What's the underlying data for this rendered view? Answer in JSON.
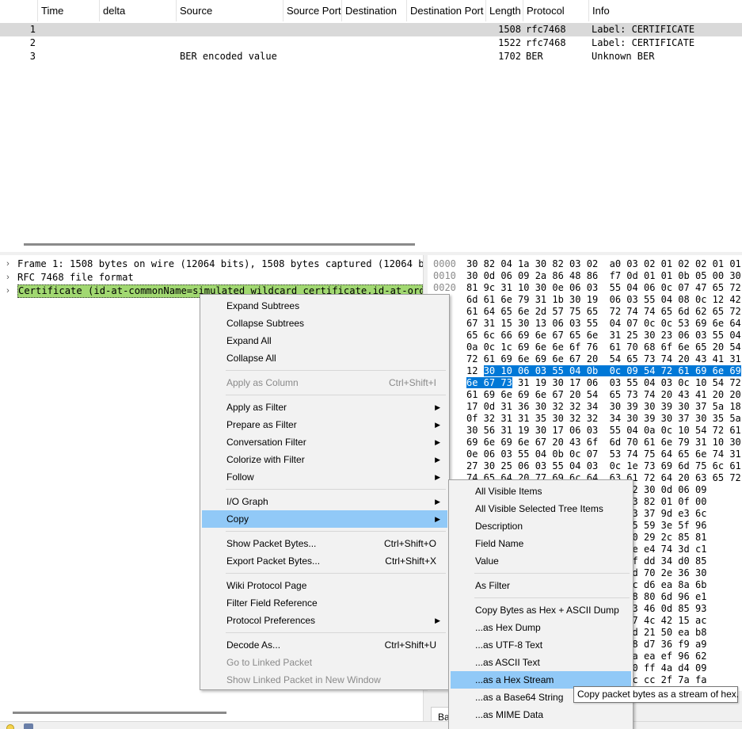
{
  "packet_list": {
    "columns": [
      "Time",
      "delta",
      "Source",
      "Source Port",
      "Destination",
      "Destination Port",
      "Length",
      "Protocol",
      "Info"
    ],
    "rows": [
      {
        "no": "1",
        "source": "",
        "length": "1508",
        "protocol": "rfc7468",
        "info": "Label: CERTIFICATE"
      },
      {
        "no": "2",
        "source": "",
        "length": "1522",
        "protocol": "rfc7468",
        "info": "Label: CERTIFICATE"
      },
      {
        "no": "3",
        "source": "BER encoded value",
        "length": "1702",
        "protocol": "BER",
        "info": "Unknown BER"
      }
    ]
  },
  "details": {
    "rows": [
      "Frame 1: 1508 bytes on wire (12064 bits), 1508 bytes captured (12064 bits)",
      "RFC 7468 file format",
      "Certificate (id-at-commonName=simulated wildcard certificate,id-at-organi"
    ]
  },
  "bytes": {
    "rows": [
      {
        "off": "0000",
        "hex": "30 82 04 1a 30 82 03 02  a0 03 02 01 02 02 01 01"
      },
      {
        "off": "0010",
        "hex": "30 0d 06 09 2a 86 48 86  f7 0d 01 01 0b 05 00 30"
      },
      {
        "off": "0020",
        "hex": "81 9c 31 10 30 0e 06 03  55 04 06 0c 07 47 65 72"
      },
      {
        "off": "",
        "hex": "6d 61 6e 79 31 1b 30 19  06 03 55 04 08 0c 12 42"
      },
      {
        "off": "",
        "hex": "61 64 65 6e 2d 57 75 65  72 74 74 65 6d 62 65 72"
      },
      {
        "off": "",
        "hex": "67 31 15 30 13 06 03 55  04 07 0c 0c 53 69 6e 64"
      },
      {
        "off": "",
        "hex": "65 6c 66 69 6e 67 65 6e  31 25 30 23 06 03 55 04"
      },
      {
        "off": "",
        "hex": "0a 0c 1c 69 6e 6e 6f 76  61 70 68 6f 6e 65 20 54"
      },
      {
        "off": "",
        "hex": "72 61 69 6e 69 6e 67 20  54 65 73 74 20 43 41 31"
      },
      {
        "off": "",
        "hex": "12 ",
        "sel": "30 10 06 03 55 04 0b  0c 09 54 72 61 69 6e 69"
      },
      {
        "off": "",
        "hex": "",
        "sel": "6e 67 73",
        "tail": " 31 19 30 17 06  03 55 04 03 0c 10 54 72"
      },
      {
        "off": "",
        "hex": "61 69 6e 69 6e 67 20 54  65 73 74 20 43 41 20 20"
      },
      {
        "off": "",
        "hex": "17 0d 31 36 30 32 32 34  30 39 30 39 30 37 5a 18"
      },
      {
        "off": "",
        "hex": "0f 32 31 31 35 30 32 32  34 30 39 30 37 30 35 5a"
      },
      {
        "off": "",
        "hex": "30 56 31 19 30 17 06 03  55 04 0a 0c 10 54 72 61"
      },
      {
        "off": "",
        "hex": "69 6e 69 6e 67 20 43 6f  6d 70 61 6e 79 31 10 30"
      },
      {
        "off": "",
        "hex": "0e 06 03 55 04 0b 0c 07  53 74 75 64 65 6e 74 31"
      },
      {
        "off": "",
        "hex": "27 30 25 06 03 55 04 03  0c 1e 73 69 6d 75 6c 61"
      },
      {
        "off": "",
        "hex": "74 65 64 20 77 69 6c 64  63 61 72 64 20 63 65 72"
      },
      {
        "off": "",
        "hex": "                         01 22 30 0d 06 09"
      },
      {
        "off": "",
        "hex": "                         00 03 82 01 0f 00"
      },
      {
        "off": "",
        "hex": "                         10 f3 37 9d e3 6c"
      },
      {
        "off": "",
        "hex": "                         b5 b5 59 3e 5f 96"
      },
      {
        "off": "",
        "hex": "                         fb 00 29 2c 85 81"
      },
      {
        "off": "",
        "hex": "                         ce fe e4 74 3d c1"
      },
      {
        "off": "",
        "hex": "                         63 df dd 34 d0 85"
      },
      {
        "off": "",
        "hex": "                         1d 5d 70 2e 36 30"
      },
      {
        "off": "",
        "hex": "                         6c fc d6 ea 8a 6b"
      },
      {
        "off": "",
        "hex": "                         07 a8 80 6d 96 e1"
      },
      {
        "off": "",
        "hex": "                         4d 93 46 0d 85 93"
      },
      {
        "off": "",
        "hex": "                         ec 77 4c 42 15 ac"
      },
      {
        "off": "",
        "hex": "                         85 5d 21 50 ea b8"
      },
      {
        "off": "",
        "hex": "                         4a e8 d7 36 f9 a9"
      },
      {
        "off": "",
        "hex": "                         d6 ca ea ef 96 62"
      },
      {
        "off": "",
        "hex": "                         3b 60 ff 4a d4 09"
      },
      {
        "off": "",
        "hex": "                         ad 9c cc 2f 7a fa"
      }
    ],
    "tab_label": "Ba"
  },
  "context_menu": {
    "items": [
      {
        "label": "Expand Subtrees"
      },
      {
        "label": "Collapse Subtrees"
      },
      {
        "label": "Expand All"
      },
      {
        "label": "Collapse All"
      },
      {
        "label": "Apply as Column",
        "shortcut": "Ctrl+Shift+I",
        "disabled": true
      },
      {
        "label": "Apply as Filter",
        "submenu": true
      },
      {
        "label": "Prepare as Filter",
        "submenu": true
      },
      {
        "label": "Conversation Filter",
        "submenu": true
      },
      {
        "label": "Colorize with Filter",
        "submenu": true
      },
      {
        "label": "Follow",
        "submenu": true
      },
      {
        "label": "I/O Graph",
        "submenu": true
      },
      {
        "label": "Copy",
        "submenu": true,
        "highlighted": true
      },
      {
        "label": "Show Packet Bytes...",
        "shortcut": "Ctrl+Shift+O"
      },
      {
        "label": "Export Packet Bytes...",
        "shortcut": "Ctrl+Shift+X"
      },
      {
        "label": "Wiki Protocol Page"
      },
      {
        "label": "Filter Field Reference"
      },
      {
        "label": "Protocol Preferences",
        "submenu": true
      },
      {
        "label": "Decode As...",
        "shortcut": "Ctrl+Shift+U"
      },
      {
        "label": "Go to Linked Packet",
        "disabled": true
      },
      {
        "label": "Show Linked Packet in New Window",
        "disabled": true
      }
    ]
  },
  "copy_submenu": {
    "items": [
      {
        "label": "All Visible Items"
      },
      {
        "label": "All Visible Selected Tree Items"
      },
      {
        "label": "Description"
      },
      {
        "label": "Field Name"
      },
      {
        "label": "Value"
      },
      {
        "label": "As Filter"
      },
      {
        "label": "Copy Bytes as Hex + ASCII Dump"
      },
      {
        "label": "...as Hex Dump"
      },
      {
        "label": "...as UTF-8 Text"
      },
      {
        "label": "...as ASCII Text"
      },
      {
        "label": "...as a Hex Stream",
        "highlighted": true
      },
      {
        "label": "...as a Base64 String"
      },
      {
        "label": "...as MIME Data"
      }
    ]
  },
  "tooltip": {
    "text": "Copy packet bytes as a stream of hex."
  },
  "colors": {
    "selection_blue": "#0078d7",
    "menu_highlight": "#91c9f7",
    "tree_highlight": "#a1d871"
  }
}
